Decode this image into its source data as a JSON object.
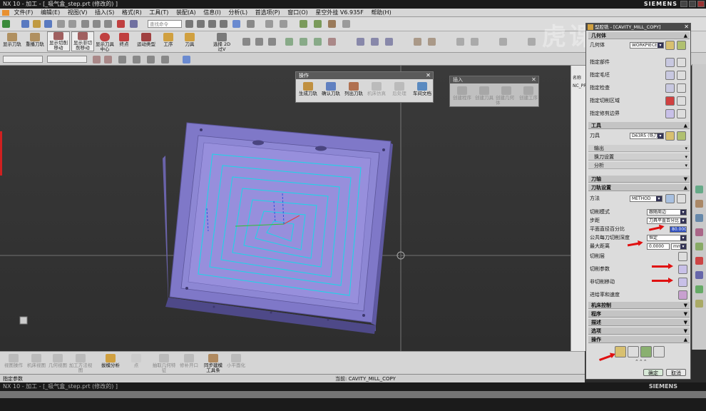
{
  "window": {
    "title": "NX 10 - 加工 - [_吸气盒_step.prt (修改的) ]",
    "brand": "SIEMENS",
    "title_bottom": "NX 10 - 加工 - [_吸气盒_step.prt (修改的) ]"
  },
  "menu": [
    "文件(F)",
    "编辑(E)",
    "视图(V)",
    "插入(S)",
    "格式(R)",
    "工具(T)",
    "装配(A)",
    "信息(I)",
    "分析(L)",
    "首选项(P)",
    "窗口(O)",
    "星空外挂 V6.935F",
    "帮助(H)"
  ],
  "search_placeholder": "查找命令",
  "toolbar_main": [
    "显示刀轨",
    "重播刀轨",
    "显示切削移动",
    "显示非切削移动",
    "显示刀具中心",
    "终点",
    "运动类型",
    "工序",
    "刀具",
    "选择 2D 过V"
  ],
  "float_ops": {
    "title": "操作",
    "buttons": [
      "生成刀轨",
      "确认刀轨",
      "列出刀轨",
      "机床仿真",
      "后处理",
      "车间文档"
    ]
  },
  "float_insert": {
    "title": "插入",
    "buttons": [
      "创建程序",
      "创建刀具",
      "创建几何体",
      "创建工序"
    ]
  },
  "bottom_tools": [
    "视图操作",
    "机床视图",
    "几何视图",
    "加工方法视图",
    "拔模分析",
    "点",
    "抽取几何特征",
    "修补开口",
    "同步建模工具条",
    "小平面化"
  ],
  "status": {
    "left": "指定参数",
    "current": "当前: CAVITY_MILL_COPY"
  },
  "nav_tree": {
    "header": "名称",
    "item": "NC_PR"
  },
  "dialog": {
    "title": "型腔铣 - [CAVITY_MILL_COPY]",
    "geometry": {
      "section": "几何体",
      "label": "几何体",
      "value": "WORKPIECE",
      "rows": [
        "指定部件",
        "指定毛坯",
        "指定检查",
        "指定切削区域",
        "指定修剪边界"
      ]
    },
    "tool": {
      "section": "工具",
      "label": "刀具",
      "value": "D63R5 (铣刀",
      "subs": [
        "输出",
        "换刀设置"
      ],
      "analysis": "分析"
    },
    "axis": "刀轴",
    "path": {
      "section": "刀轨设置",
      "method_label": "方法",
      "method_value": "METHOD",
      "cut_mode_label": "切削模式",
      "cut_mode_value": "跟随周边",
      "stepover_label": "步距",
      "stepover_value": "刀具平直百分比",
      "percent_label": "平面直径百分比",
      "percent_value": "80.0000",
      "depth_label": "公共每刀切削深度",
      "depth_value": "恒定",
      "maxdist_label": "最大距离",
      "maxdist_value": "0.0000",
      "maxdist_unit": "mm",
      "rows": [
        "切削层",
        "切削参数",
        "非切削移动",
        "进给率和速度"
      ]
    },
    "collapsed": [
      "机床控制",
      "程序",
      "描述",
      "选项",
      "操作"
    ],
    "ok": "确定",
    "cancel": "取消"
  },
  "watermark": "虎课网",
  "colors": {
    "part": "#7f78c8",
    "toolpath": "#18d8e8",
    "arrow": "#e01010",
    "dialog_header": "#4a4a4a"
  }
}
